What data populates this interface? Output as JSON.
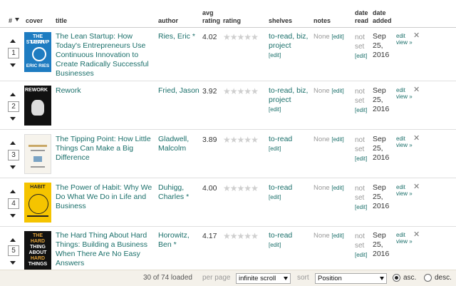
{
  "header": {
    "num": "#",
    "cover": "cover",
    "title": "title",
    "author": "author",
    "avg_rating_l1": "avg",
    "avg_rating_l2": "rating",
    "rating": "rating",
    "shelves": "shelves",
    "notes": "notes",
    "date_read_l1": "date",
    "date_read_l2": "read",
    "date_added_l1": "date",
    "date_added_l2": "added"
  },
  "books": [
    {
      "position": "1",
      "title": "The Lean Startup: How Today's Entrepreneurs Use Continuous Innovation to Create Radically Successful Businesses",
      "author": "Ries, Eric *",
      "avg_rating": "4.02",
      "shelves": "to-read, biz, project",
      "edit_link": "[edit]",
      "notes": "None",
      "notes_edit": "[edit]",
      "date_read": "not set",
      "date_read_edit": "[edit]",
      "date_added": "Sep 25, 2016",
      "edit": "edit",
      "view": "view »"
    },
    {
      "position": "2",
      "title": "Rework",
      "author": "Fried, Jason",
      "avg_rating": "3.92",
      "shelves": "to-read, biz, project",
      "edit_link": "[edit]",
      "notes": "None",
      "notes_edit": "[edit]",
      "date_read": "not set",
      "date_read_edit": "[edit]",
      "date_added": "Sep 25, 2016",
      "edit": "edit",
      "view": "view »"
    },
    {
      "position": "3",
      "title": "The Tipping Point: How Little Things Can Make a Big Difference",
      "author": "Gladwell, Malcolm",
      "avg_rating": "3.89",
      "shelves": "to-read",
      "edit_link": "[edit]",
      "notes": "None",
      "notes_edit": "[edit]",
      "date_read": "not set",
      "date_read_edit": "[edit]",
      "date_added": "Sep 25, 2016",
      "edit": "edit",
      "view": "view »"
    },
    {
      "position": "4",
      "title": "The Power of Habit: Why We Do What We Do in Life and Business",
      "author": "Duhigg, Charles *",
      "avg_rating": "4.00",
      "shelves": "to-read",
      "edit_link": "[edit]",
      "notes": "None",
      "notes_edit": "[edit]",
      "date_read": "not set",
      "date_read_edit": "[edit]",
      "date_added": "Sep 25, 2016",
      "edit": "edit",
      "view": "view »"
    },
    {
      "position": "5",
      "title": "The Hard Thing About Hard Things: Building a Business When There Are No Easy Answers",
      "author": "Horowitz, Ben *",
      "avg_rating": "4.17",
      "shelves": "to-read",
      "edit_link": "[edit]",
      "notes": "None",
      "notes_edit": "[edit]",
      "date_read": "not set",
      "date_read_edit": "[edit]",
      "date_added": "Sep 25, 2016",
      "edit": "edit",
      "view": "view »"
    }
  ],
  "covers": {
    "lean_top": "THE LEAN",
    "lean_mid": "STARTUP",
    "lean_bottom": "ERIC RIES",
    "rework": "REWORK",
    "habit": "HABIT",
    "hard_1": "THE",
    "hard_2": "HARD",
    "hard_3": "THING",
    "hard_4": "ABOUT",
    "hard_5": "HARD",
    "hard_6": "THINGS"
  },
  "footer": {
    "loaded": "30 of 74 loaded",
    "per_page_label": "per page",
    "per_page_value": "infinite scroll",
    "sort_label": "sort",
    "sort_value": "Position",
    "asc_label": "asc.",
    "desc_label": "desc.",
    "order": "asc"
  },
  "icons": {
    "move_up": "arrow-up-icon",
    "move_down": "arrow-down-icon",
    "remove": "close-icon",
    "rating_star": "star-icon"
  },
  "colors": {
    "link": "#1a6f6a",
    "footer_bg": "#f4f1ea",
    "lean_cover": "#1e7cc1",
    "habit_cover": "#f5c400"
  }
}
